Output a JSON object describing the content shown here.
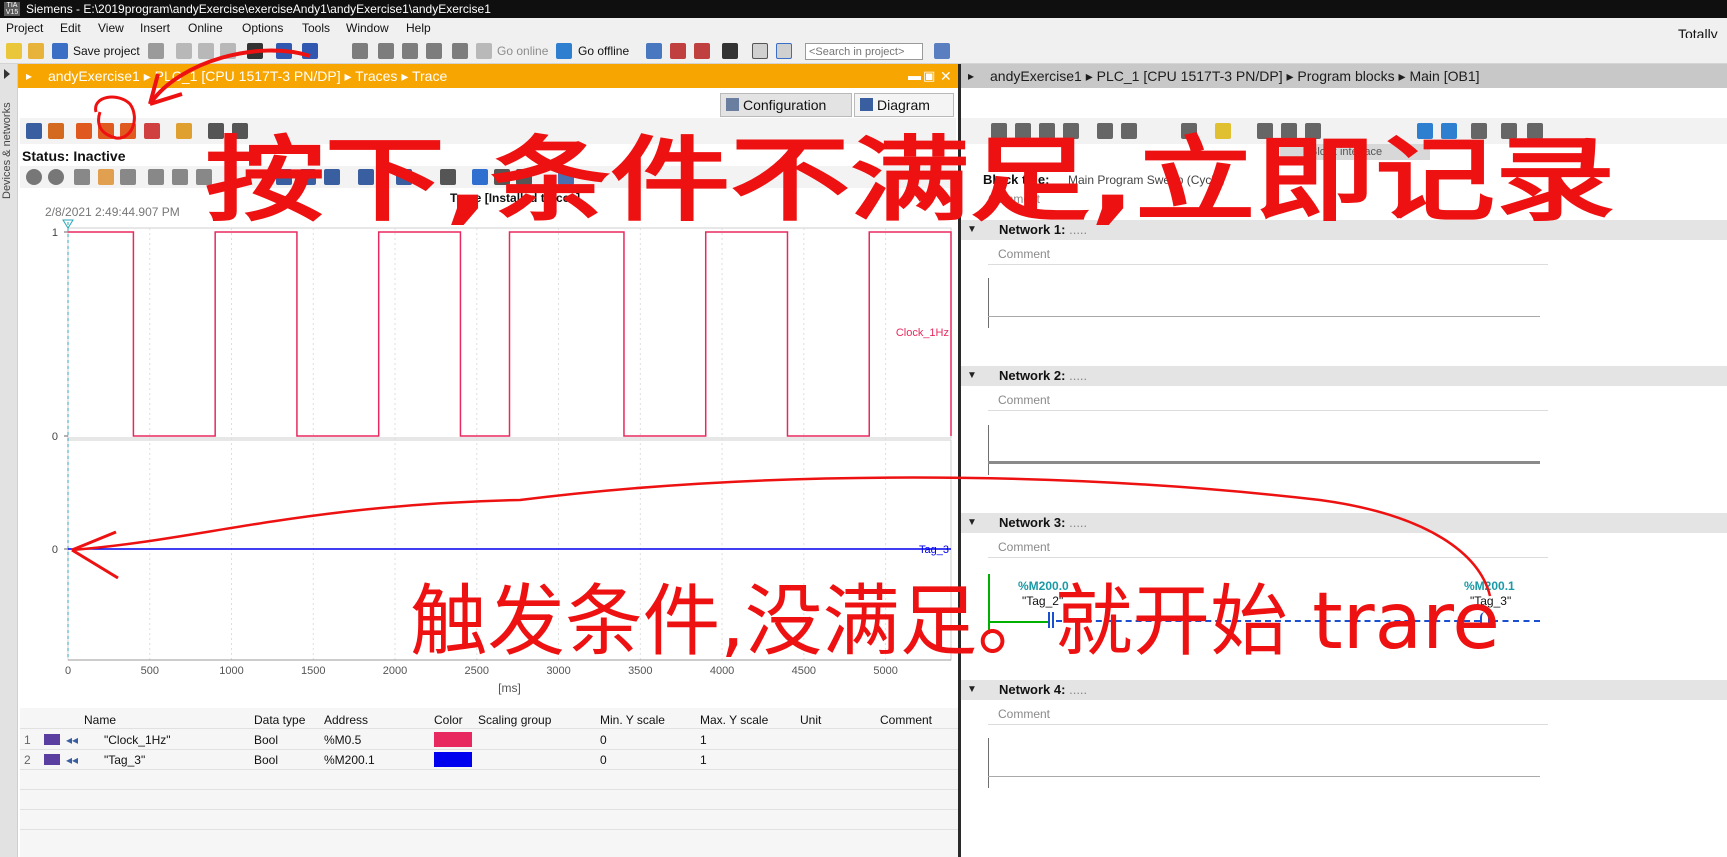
{
  "window": {
    "title": "Siemens  -  E:\\2019program\\andyExercise\\exerciseAndy1\\andyExercise1\\andyExercise1",
    "brand_right": "Totally",
    "logo": "TIA\nV15"
  },
  "menu": [
    "Project",
    "Edit",
    "View",
    "Insert",
    "Online",
    "Options",
    "Tools",
    "Window",
    "Help"
  ],
  "toolbar": {
    "save_label": "Save project",
    "go_online": "Go online",
    "go_offline": "Go offline",
    "search_placeholder": "<Search in project>"
  },
  "side_tab": "Devices & networks",
  "left_editor": {
    "breadcrumb": "andyExercise1  ▸  PLC_1 [CPU 1517T-3 PN/DP]  ▸  Traces  ▸  Trace",
    "tabs": [
      "Configuration",
      "Diagram"
    ],
    "status": "Status: Inactive",
    "timestamp": "2/8/2021  2:49:44.907 PM",
    "diagram_title": "Trace [Installed traces]"
  },
  "chart_data": {
    "type": "line",
    "xlabel": "[ms]",
    "x_ticks": [
      0,
      500,
      1000,
      1500,
      2000,
      2500,
      3000,
      3500,
      4000,
      4500,
      5000
    ],
    "xlim": [
      0,
      5400
    ],
    "series": [
      {
        "name": "Clock_1Hz",
        "color": "#e8295f",
        "y_ticks": [
          "1",
          "0"
        ],
        "steps": [
          [
            0,
            1
          ],
          [
            400,
            0
          ],
          [
            900,
            1
          ],
          [
            1400,
            0
          ],
          [
            1900,
            1
          ],
          [
            2400,
            0
          ],
          [
            2700,
            1
          ],
          [
            3400,
            0
          ],
          [
            3900,
            1
          ],
          [
            4400,
            0
          ],
          [
            4900,
            1
          ],
          [
            5400,
            0
          ]
        ]
      },
      {
        "name": "Tag_3",
        "color": "#0000ee",
        "y_ticks": [
          "0"
        ],
        "steps": [
          [
            0,
            0
          ],
          [
            5400,
            0
          ]
        ]
      }
    ]
  },
  "signals_table": {
    "headers": [
      "Name",
      "Data type",
      "Address",
      "Color",
      "Scaling group",
      "Min. Y scale",
      "Max. Y scale",
      "Unit",
      "Comment"
    ],
    "rows": [
      {
        "no": "1",
        "name": "\"Clock_1Hz\"",
        "type": "Bool",
        "address": "%M0.5",
        "color": "#e8295f",
        "min": "0",
        "max": "1"
      },
      {
        "no": "2",
        "name": "\"Tag_3\"",
        "type": "Bool",
        "address": "%M200.1",
        "color": "#0000ee",
        "min": "0",
        "max": "1"
      }
    ]
  },
  "right_editor": {
    "breadcrumb": "andyExercise1  ▸  PLC_1 [CPU 1517T-3 PN/DP]  ▸  Program blocks  ▸  Main [OB1]",
    "block_interface": "Block interface",
    "block_title_label": "Block title:",
    "block_title_value": "Main Program Sweep (Cycle)",
    "comment_label": "Comment",
    "networks": [
      {
        "label": "Network 1:",
        "dots": "....."
      },
      {
        "label": "Network 2:",
        "dots": "....."
      },
      {
        "label": "Network 3:",
        "dots": "....."
      },
      {
        "label": "Network 4:",
        "dots": "....."
      }
    ],
    "network3_ops": [
      {
        "addr": "%M200.0",
        "name": "\"Tag_2\""
      },
      {
        "addr": "%M200.1",
        "name": "\"Tag_3\""
      }
    ]
  },
  "annotations": {
    "top": "按下,条件不满足,立即记录",
    "bottom": "触发条件,没满足。就开始 trare"
  }
}
